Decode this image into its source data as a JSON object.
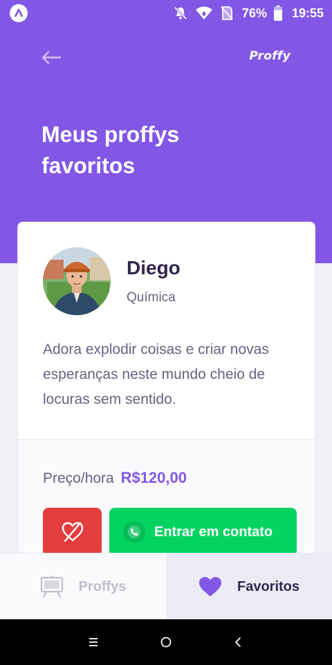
{
  "status_bar": {
    "battery": "76%",
    "time": "19:55",
    "icons": [
      "app-icon",
      "bell-off-icon",
      "wifi-icon",
      "no-sim-icon",
      "battery-icon"
    ]
  },
  "header": {
    "back_icon": "arrow-left-icon",
    "logo": "Proffy",
    "title": "Meus proffys favoritos"
  },
  "teacher": {
    "name": "Diego",
    "subject": "Química",
    "bio": "Adora explodir coisas e criar novas esperanças neste mundo cheio de locuras sem sentido.",
    "price_label": "Preço/hora",
    "price_value": "R$120,00",
    "unfavorite_icon": "heart-off-icon",
    "contact_label": "Entrar em contato",
    "contact_icon": "whatsapp-icon"
  },
  "tabs": [
    {
      "label": "Proffys",
      "icon": "easel-icon",
      "active": false
    },
    {
      "label": "Favoritos",
      "icon": "heart-icon",
      "active": true
    }
  ],
  "colors": {
    "primary": "#8257E5",
    "background": "#F0F0F7",
    "title": "#32264D",
    "text": "#6A6180",
    "danger": "#E33D3D",
    "success": "#04D361",
    "inactive": "#C1BCCC"
  },
  "nav_bar": {
    "icons": [
      "menu-icon",
      "home-icon",
      "back-icon"
    ]
  }
}
